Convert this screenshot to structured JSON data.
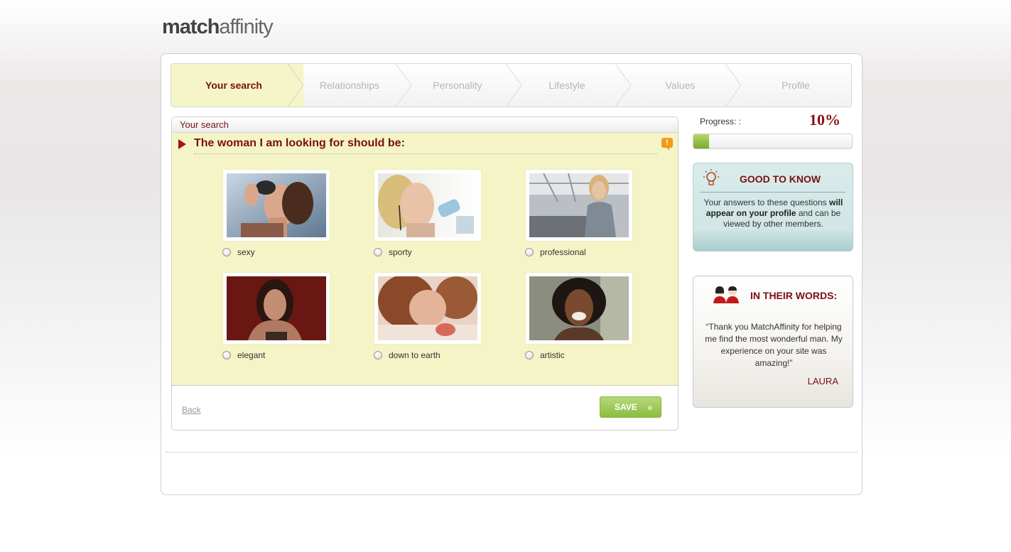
{
  "brand": {
    "logo_bold": "match",
    "logo_light": "affinity"
  },
  "steps": [
    {
      "label": "Your search",
      "active": true
    },
    {
      "label": "Relationships",
      "active": false
    },
    {
      "label": "Personality",
      "active": false
    },
    {
      "label": "Lifestyle",
      "active": false
    },
    {
      "label": "Values",
      "active": false
    },
    {
      "label": "Profile",
      "active": false
    }
  ],
  "panel": {
    "header": "Your search",
    "question": "The woman I am looking for should be:",
    "options": [
      {
        "label": "sexy",
        "icon": "photo-sexy"
      },
      {
        "label": "sporty",
        "icon": "photo-sporty"
      },
      {
        "label": "professional",
        "icon": "photo-professional"
      },
      {
        "label": "elegant",
        "icon": "photo-elegant"
      },
      {
        "label": "down to earth",
        "icon": "photo-down-to-earth"
      },
      {
        "label": "artistic",
        "icon": "photo-artistic"
      }
    ],
    "back_label": "Back",
    "save_label": "SAVE",
    "save_chevron": "»"
  },
  "progress": {
    "label": "Progress: :",
    "value_text": "10%",
    "value": 0.1
  },
  "good_to_know": {
    "title": "GOOD TO KNOW",
    "text_before": "Your answers to these questions ",
    "text_bold": "will appear on your profile",
    "text_after": " and can be viewed by other members."
  },
  "testimonial": {
    "title": "IN THEIR WORDS:",
    "quote": "“Thank you MatchAffinity for helping me find the most wonderful man. My experience on your site was amazing!”",
    "author": "LAURA"
  },
  "colors": {
    "accent": "#7a1010",
    "panel_bg": "#f4f4c6",
    "save_green": "#8cbd3e",
    "tip_bg": "#d2e6e6"
  }
}
